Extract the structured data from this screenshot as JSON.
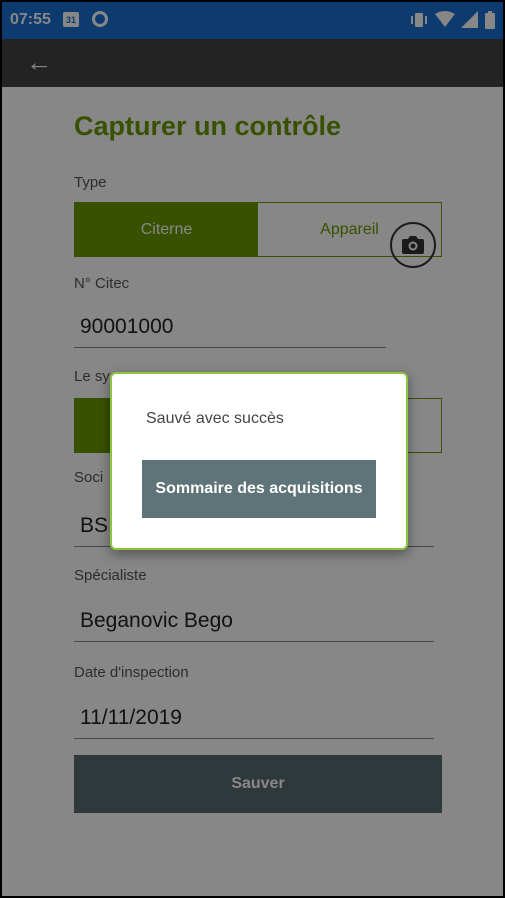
{
  "status_bar": {
    "time": "07:55",
    "calendar_day": "31"
  },
  "app_bar": {
    "back_icon": "arrow-left-icon"
  },
  "form": {
    "title": "Capturer un contrôle",
    "type_label": "Type",
    "type_options": [
      "Citerne",
      "Appareil"
    ],
    "type_selected": "Citerne",
    "citec_label": "N° Citec",
    "citec_value": "90001000",
    "system_label_partial": "Le sy",
    "societe_label_partial": "Soci",
    "societe_value_partial": "BS",
    "specialist_label": "Spécialiste",
    "specialist_value": "Beganovic Bego",
    "date_label": "Date d'inspection",
    "date_value": "11/11/2019",
    "save_label": "Sauver"
  },
  "dialog": {
    "message": "Sauvé avec succès",
    "button_label": "Sommaire des acquisitions"
  },
  "colors": {
    "accent": "#6a9a00",
    "status_bar": "#1a6fd1",
    "app_bar": "#424242",
    "dialog_border": "#8bc63e"
  }
}
